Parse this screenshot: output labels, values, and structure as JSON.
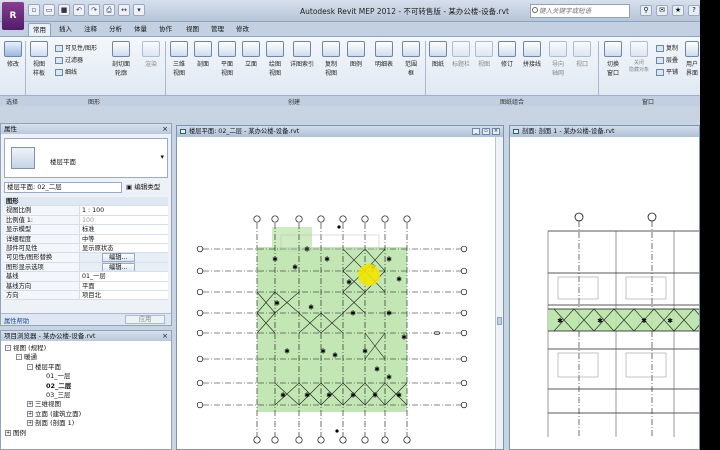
{
  "app": {
    "logo_text": "R",
    "title": "Autodesk Revit MEP 2012 - 不可转售版 - 某办公楼-设备.rvt",
    "search_placeholder": "键入关键字或短语",
    "quick_access": [
      "新建",
      "打开",
      "保存",
      "撤消",
      "重做",
      "打印",
      "测量"
    ],
    "title_icons": [
      "搜索",
      "通讯中心",
      "收藏夹",
      "帮助"
    ]
  },
  "tabs": [
    {
      "label": "常用",
      "active": true
    },
    {
      "label": "插入",
      "active": false
    },
    {
      "label": "注释",
      "active": false
    },
    {
      "label": "分析",
      "active": false
    },
    {
      "label": "体量",
      "active": false
    },
    {
      "label": "协作",
      "active": false
    },
    {
      "label": "视图",
      "active": false
    },
    {
      "label": "管理",
      "active": false
    },
    {
      "label": "修改",
      "active": false
    }
  ],
  "ribbon": {
    "modify_label": "修改",
    "small_buttons": [
      "可见性/图形",
      "过滤器",
      "细线"
    ],
    "graphics_buttons": [
      "视图\n样板",
      "剖切面\n轮廓",
      "渲染"
    ],
    "create_buttons": [
      "三维\n视图",
      "剖面",
      "平面\n视图",
      "立面",
      "绘图\n视图",
      "详图索引",
      "复制\n视图",
      "图例",
      "明细表",
      "范围\n框",
      "图纸",
      "标题栏",
      "视图",
      "修订",
      "拼接线",
      "导向\n轴网",
      "视口"
    ],
    "window_buttons": [
      "切换\n窗口",
      "关闭\n隐藏对象"
    ],
    "window_small": [
      "复制",
      "层叠",
      "平铺"
    ],
    "user_interface": "用户\n界面",
    "panel_labels": [
      "选择",
      "图形",
      "创建",
      "图纸组合",
      "窗口"
    ]
  },
  "properties": {
    "title": "属性",
    "type_name": "楼层平面",
    "view_selector": "楼层平面: 02_二层",
    "edit_type": "编辑类型",
    "rows": [
      {
        "key": "图形",
        "value": "",
        "group": true
      },
      {
        "key": "视图比例",
        "value": "1 : 100"
      },
      {
        "key": "比例值 1:",
        "value": "100",
        "gray": true
      },
      {
        "key": "显示模型",
        "value": "标准"
      },
      {
        "key": "详细程度",
        "value": "中等"
      },
      {
        "key": "部件可见性",
        "value": "显示原状态"
      },
      {
        "key": "可见性/图形替换",
        "value": "编辑...",
        "button": true
      },
      {
        "key": "图形显示选项",
        "value": "编辑...",
        "button": true
      },
      {
        "key": "基线",
        "value": "01_一层"
      },
      {
        "key": "基线方向",
        "value": "平面"
      },
      {
        "key": "方向",
        "value": "项目北"
      }
    ],
    "help_link": "属性帮助",
    "apply": "应用"
  },
  "project_browser": {
    "title": "项目浏览器 - 某办公楼-设备.rvt",
    "nodes": [
      {
        "label": "视图 (规程)",
        "level": 0,
        "expander": "-"
      },
      {
        "label": "暖通",
        "level": 1,
        "expander": "-"
      },
      {
        "label": "楼层平面",
        "level": 2,
        "expander": "-"
      },
      {
        "label": "01_一层",
        "level": 3,
        "expander": ""
      },
      {
        "label": "02_二层",
        "level": 3,
        "expander": "",
        "bold": true
      },
      {
        "label": "03_三层",
        "level": 3,
        "expander": ""
      },
      {
        "label": "三维视图",
        "level": 2,
        "expander": "+"
      },
      {
        "label": "立面 (建筑立面)",
        "level": 2,
        "expander": "+"
      },
      {
        "label": "剖面 (剖面 1)",
        "level": 2,
        "expander": "+"
      },
      {
        "label": "图例",
        "level": 0,
        "expander": "+"
      }
    ]
  },
  "views": {
    "plan_title": "楼层平面: 02_二层 - 某办公楼-设备.rvt",
    "section_title": "剖面: 剖面 1 - 某办公楼-设备.rvt"
  },
  "colors": {
    "green_fill": "#b9e3a7",
    "highlight": "#f2e500",
    "grid_line": "#111111"
  }
}
